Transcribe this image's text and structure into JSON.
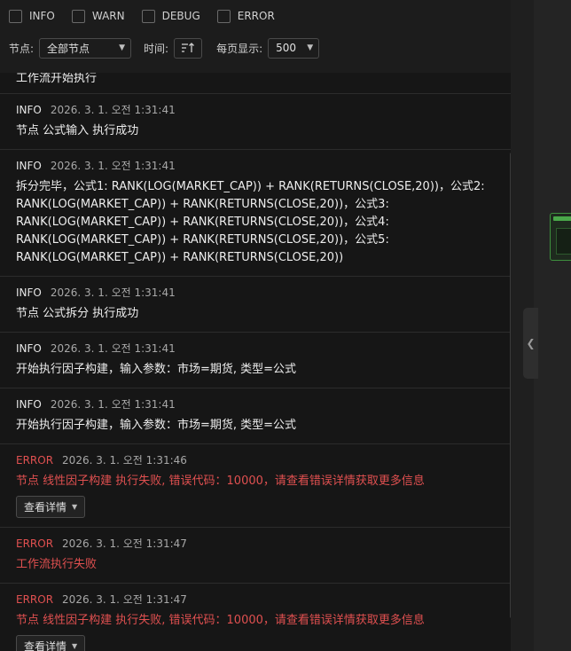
{
  "filters": [
    {
      "label": "INFO",
      "checked": false
    },
    {
      "label": "WARN",
      "checked": false
    },
    {
      "label": "DEBUG",
      "checked": false
    },
    {
      "label": "ERROR",
      "checked": false
    }
  ],
  "toolbar": {
    "node_label": "节点:",
    "node_value": "全部节点",
    "time_label": "时间:",
    "page_size_label": "每页显示:",
    "page_size_value": "500"
  },
  "partial_entry_text": "工作流开始执行",
  "logs": [
    {
      "level": "INFO",
      "time": "2026. 3. 1. 오전 1:31:41",
      "message": "节点 公式输入 执行成功"
    },
    {
      "level": "INFO",
      "time": "2026. 3. 1. 오전 1:31:41",
      "message": "拆分完毕，公式1: RANK(LOG(MARKET_CAP)) + RANK(RETURNS(CLOSE,20))，公式2: RANK(LOG(MARKET_CAP)) + RANK(RETURNS(CLOSE,20))，公式3: RANK(LOG(MARKET_CAP)) + RANK(RETURNS(CLOSE,20))，公式4: RANK(LOG(MARKET_CAP)) + RANK(RETURNS(CLOSE,20))，公式5: RANK(LOG(MARKET_CAP)) + RANK(RETURNS(CLOSE,20))"
    },
    {
      "level": "INFO",
      "time": "2026. 3. 1. 오전 1:31:41",
      "message": "节点 公式拆分 执行成功"
    },
    {
      "level": "INFO",
      "time": "2026. 3. 1. 오전 1:31:41",
      "message": "开始执行因子构建，输入参数：市场=期货, 类型=公式"
    },
    {
      "level": "INFO",
      "time": "2026. 3. 1. 오전 1:31:41",
      "message": "开始执行因子构建，输入参数：市场=期货, 类型=公式"
    },
    {
      "level": "ERROR",
      "time": "2026. 3. 1. 오전 1:31:46",
      "message": "节点 线性因子构建 执行失败, 错误代码：10000，请查看错误详情获取更多信息",
      "detail_label": "查看详情"
    },
    {
      "level": "ERROR",
      "time": "2026. 3. 1. 오전 1:31:47",
      "message": "工作流执行失败"
    },
    {
      "level": "ERROR",
      "time": "2026. 3. 1. 오전 1:31:47",
      "message": "节点 线性因子构建 执行失败, 错误代码：10000，请查看错误详情获取更多信息",
      "detail_label": "查看详情"
    }
  ],
  "colors": {
    "error": "#e05050",
    "background": "#1c1c1c",
    "node_border": "#3d8f3d"
  }
}
